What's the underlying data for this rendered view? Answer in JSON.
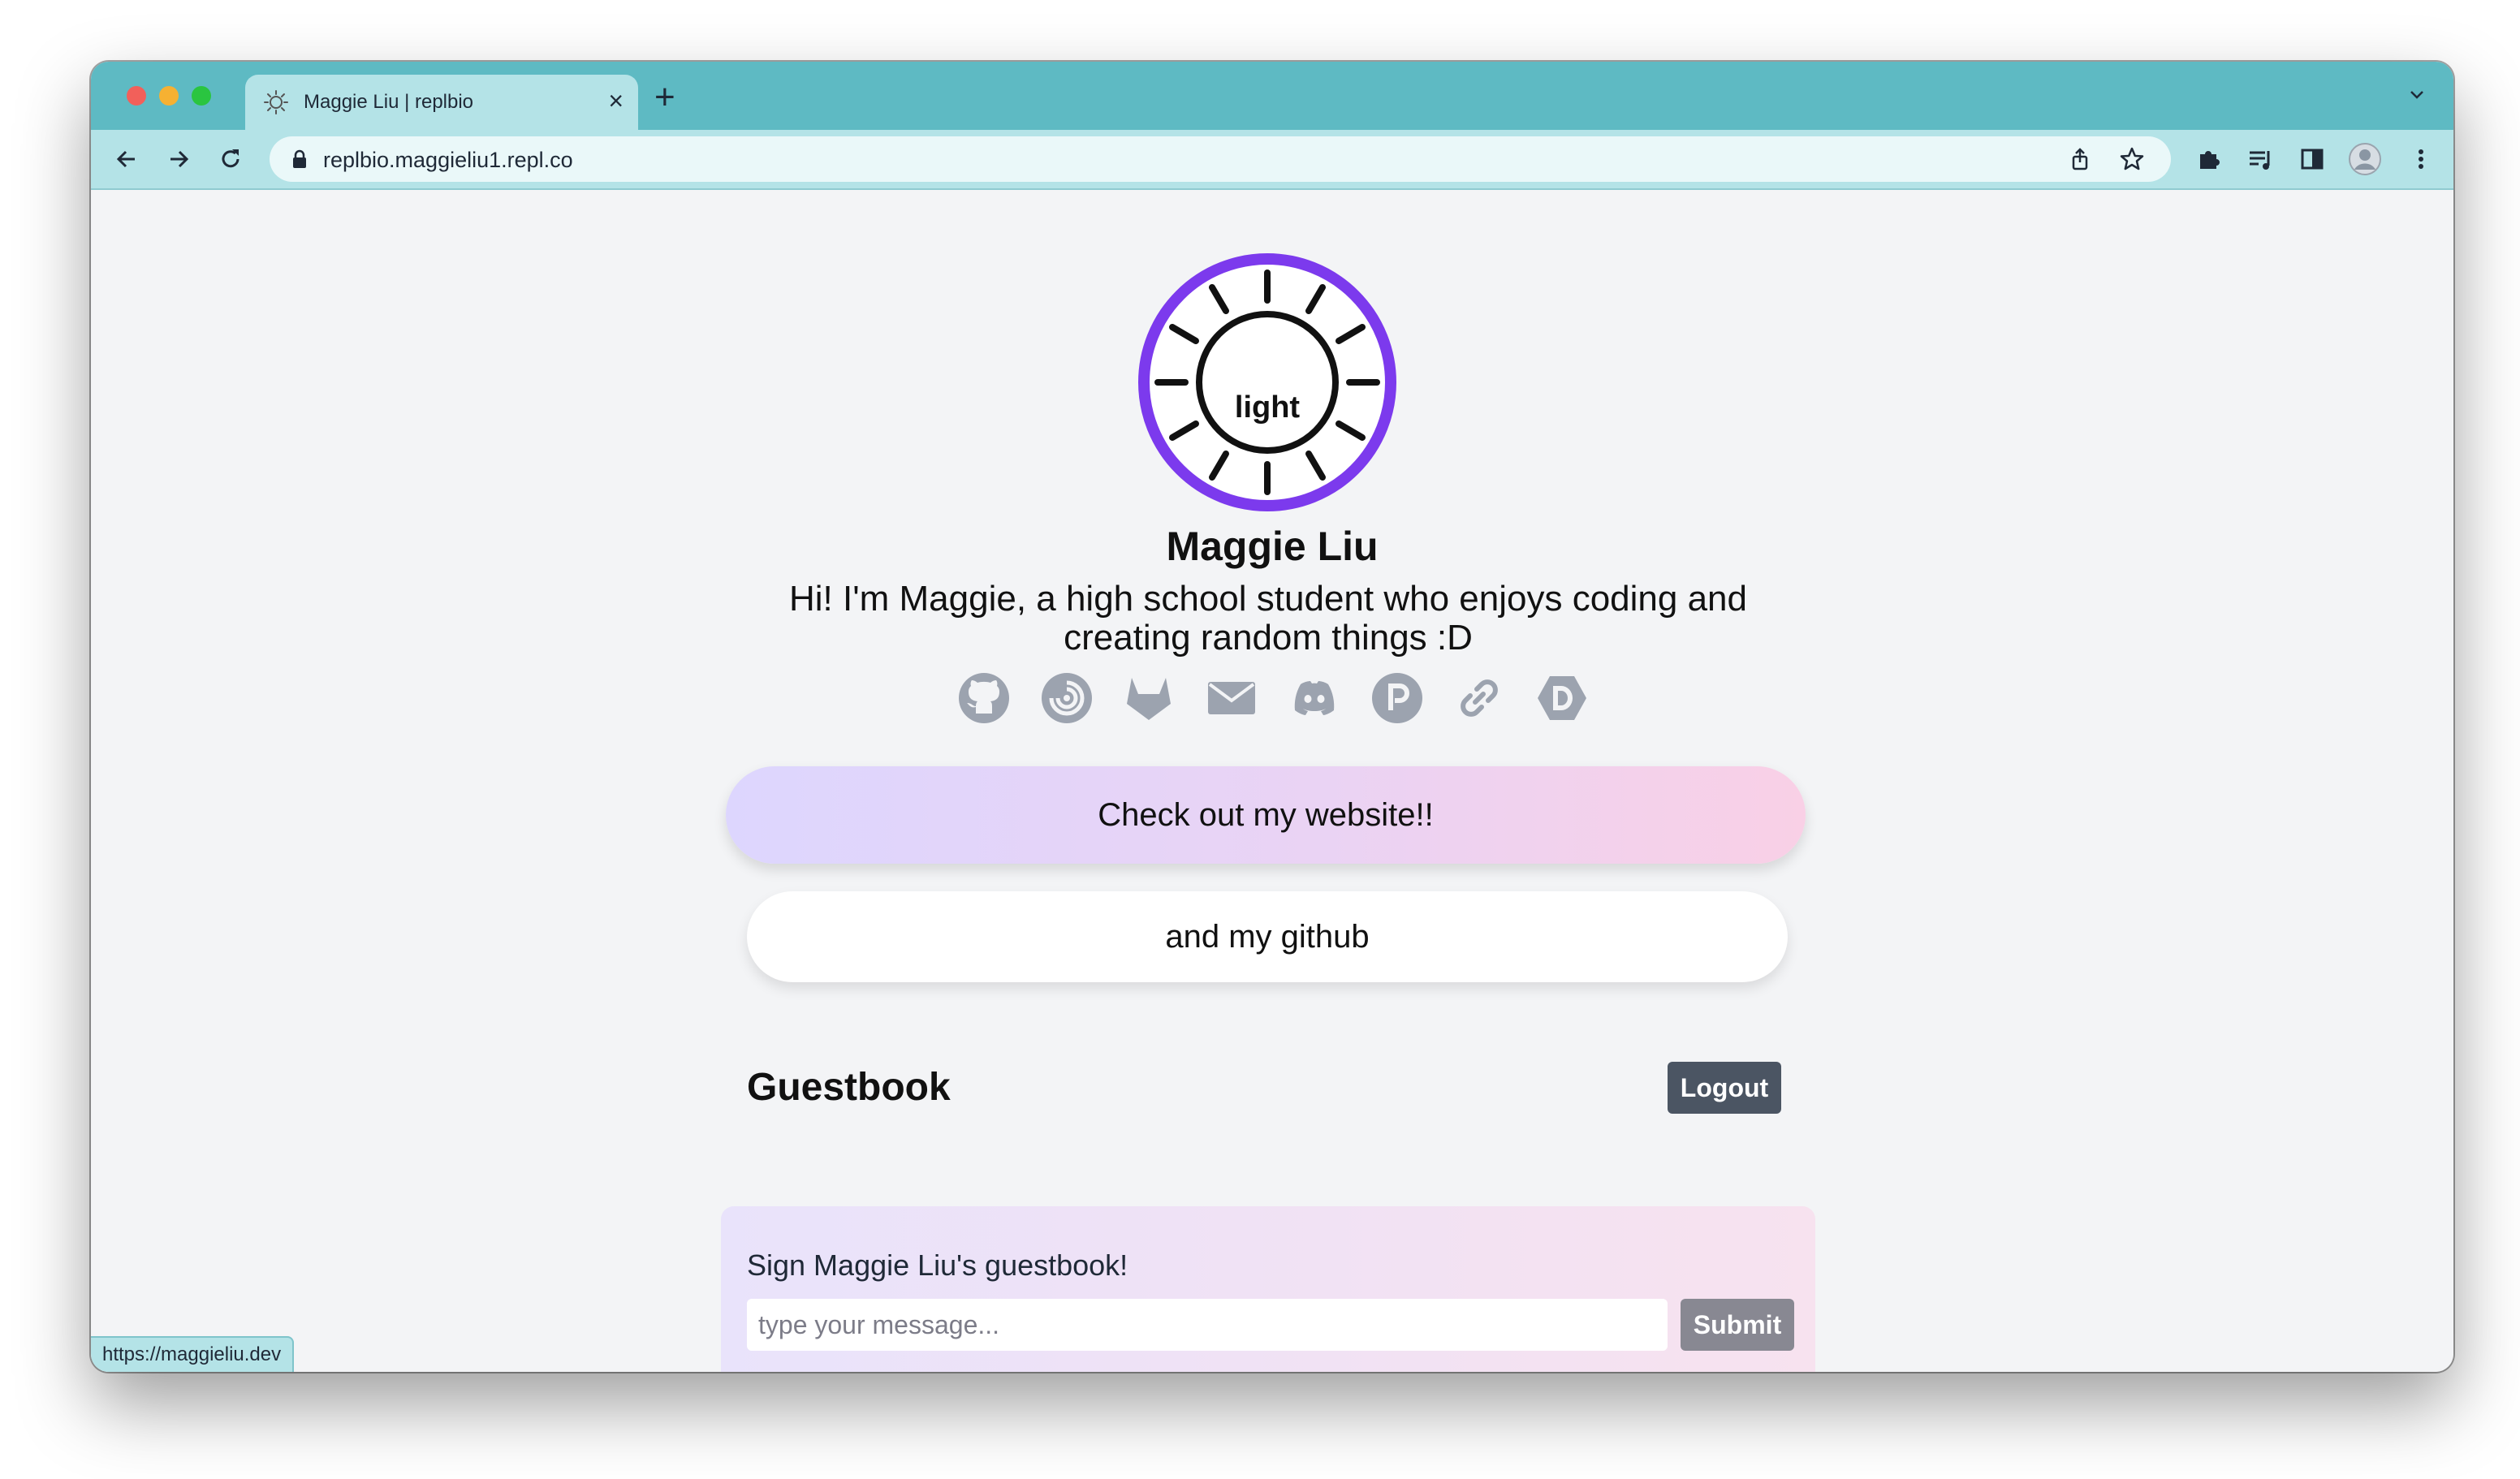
{
  "browser": {
    "tab": {
      "title": "Maggie Liu | replbio",
      "favicon": "sun-favicon-icon"
    },
    "url": "replbio.maggieliu1.repl.co",
    "status_url": "https://maggieliu.dev",
    "accent_color": "#5ebac3"
  },
  "profile": {
    "avatar_text": "light",
    "avatar_ring_color": "#7c3aed",
    "name": "Maggie Liu",
    "bio": "Hi! I'm Maggie, a high school student who enjoys coding and creating random things :D",
    "socials": [
      "github-icon",
      "replit-icon",
      "gitlab-icon",
      "email-icon",
      "discord-icon",
      "producthunt-icon",
      "link-icon",
      "devpost-icon"
    ]
  },
  "links": {
    "website_label": "Check out my website!!",
    "github_label": "and my github"
  },
  "guestbook": {
    "title": "Guestbook",
    "logout_label": "Logout",
    "prompt": "Sign Maggie Liu's guestbook!",
    "input_placeholder": "type your message...",
    "input_value": "",
    "submit_label": "Submit"
  }
}
